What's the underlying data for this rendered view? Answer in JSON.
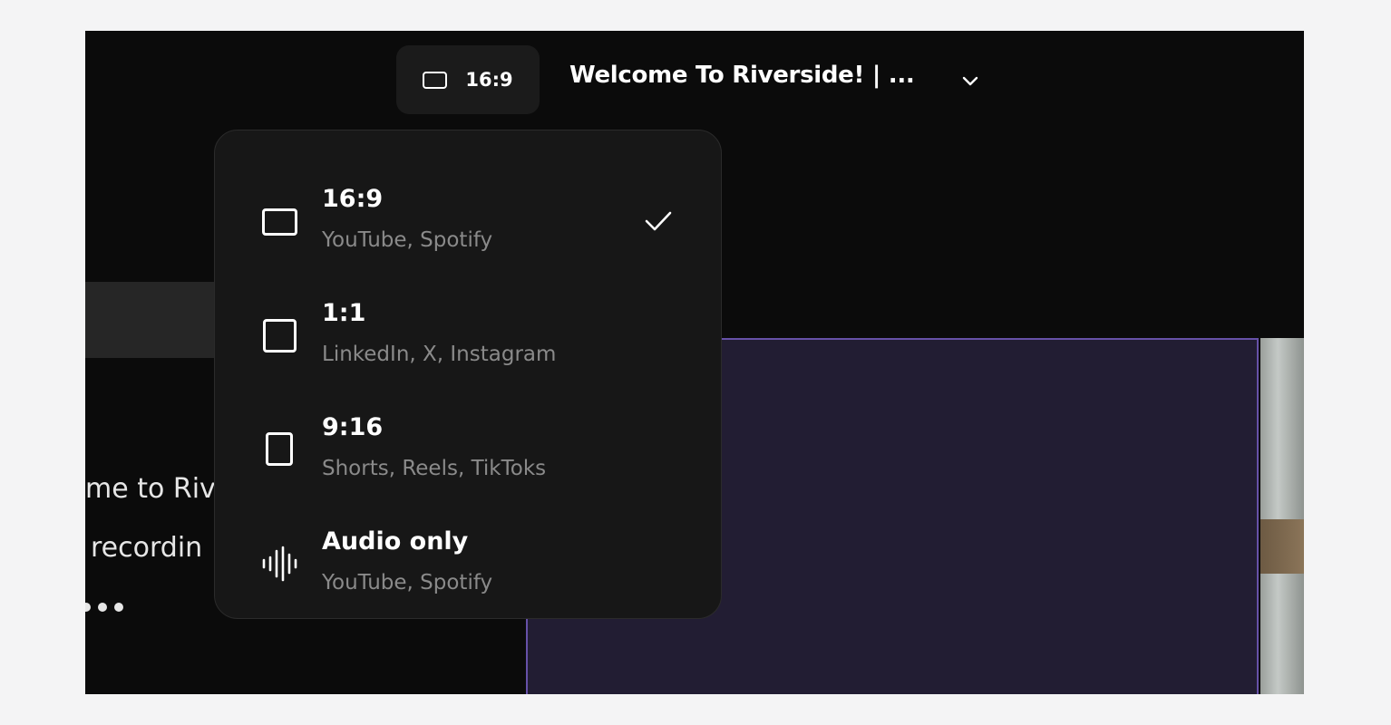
{
  "header": {
    "aspect_button_label": "16:9",
    "title": "Welcome To Riverside! | ..."
  },
  "background_text": {
    "line1": "me to Riv",
    "line2": "recordin"
  },
  "menu": {
    "items": [
      {
        "label": "16:9",
        "sub": "YouTube, Spotify",
        "icon": "landscape-rect-icon",
        "selected": true
      },
      {
        "label": "1:1",
        "sub": "LinkedIn, X, Instagram",
        "icon": "square-icon",
        "selected": false
      },
      {
        "label": "9:16",
        "sub": "Shorts, Reels, TikToks",
        "icon": "portrait-rect-icon",
        "selected": false
      },
      {
        "label": "Audio only",
        "sub": "YouTube, Spotify",
        "icon": "audio-wave-icon",
        "selected": false
      }
    ]
  },
  "colors": {
    "app_bg": "#0b0b0b",
    "menu_bg": "#171717",
    "video_panel": "#221d33",
    "video_border": "#6651a8",
    "subtext": "#8a8a8a"
  }
}
